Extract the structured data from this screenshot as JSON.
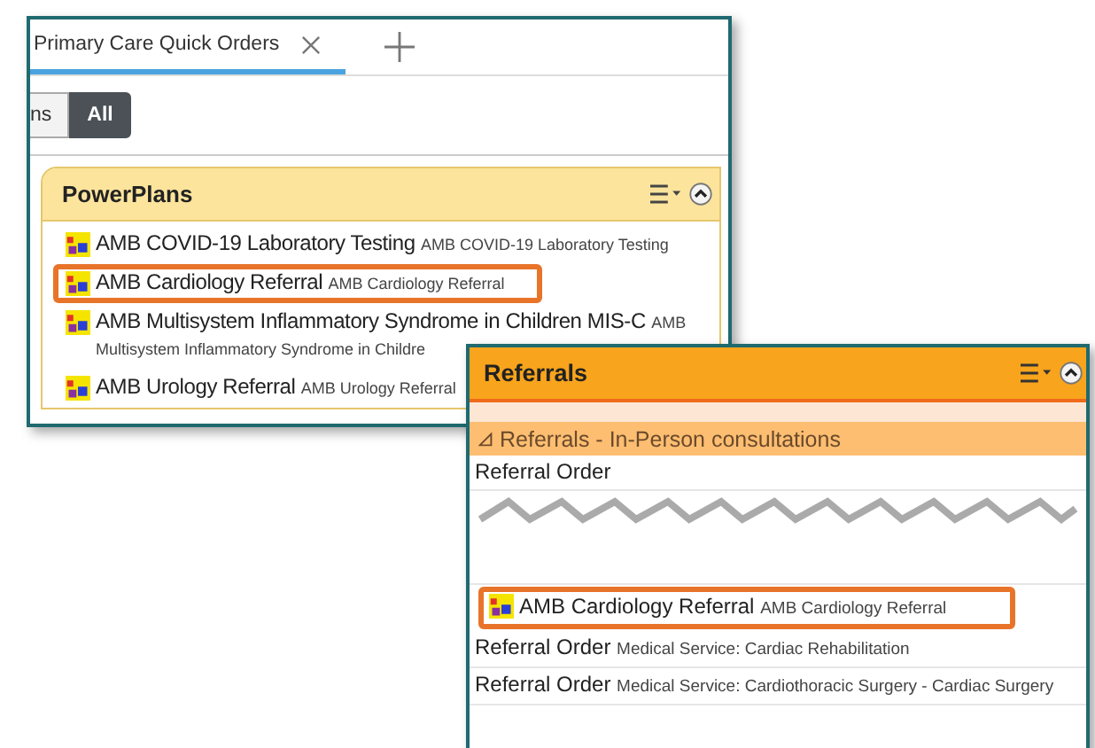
{
  "tab_bar": {
    "tabs": [
      {
        "label": "Primary Care Quick Orders",
        "selected": true
      }
    ]
  },
  "filter": {
    "options": [
      {
        "label": "ns",
        "selected": false
      },
      {
        "label": "All",
        "selected": true
      }
    ]
  },
  "powerplans": {
    "title": "PowerPlans",
    "items": [
      {
        "name": "AMB COVID-19 Laboratory Testing",
        "detail": "AMB COVID-19 Laboratory Testing",
        "highlighted": false
      },
      {
        "name": "AMB Cardiology Referral",
        "detail": "AMB Cardiology Referral",
        "highlighted": true
      },
      {
        "name": "AMB Multisystem Inflammatory Syndrome in Children MIS-C",
        "detail": "AMB",
        "detail_continued": "Multisystem Inflammatory Syndrome in Childre",
        "highlighted": false
      },
      {
        "name": "AMB Urology Referral",
        "detail": "AMB Urology Referral",
        "highlighted": false
      }
    ]
  },
  "referrals": {
    "title": "Referrals",
    "group": {
      "label": "Referrals - In-Person consultations",
      "expanded": true
    },
    "items": [
      {
        "kind": "order",
        "name": "Referral Order",
        "highlighted": false
      },
      {
        "kind": "torn"
      },
      {
        "kind": "plan",
        "name": "AMB Cardiology Referral",
        "detail": "AMB Cardiology Referral",
        "highlighted": true
      },
      {
        "kind": "order",
        "name": "Referral Order",
        "detail": "Medical Service: Cardiac Rehabilitation",
        "highlighted": false
      },
      {
        "kind": "order",
        "name": "Referral Order",
        "detail": "Medical Service: Cardiothoracic Surgery - Cardiac Surgery",
        "highlighted": false
      }
    ]
  }
}
